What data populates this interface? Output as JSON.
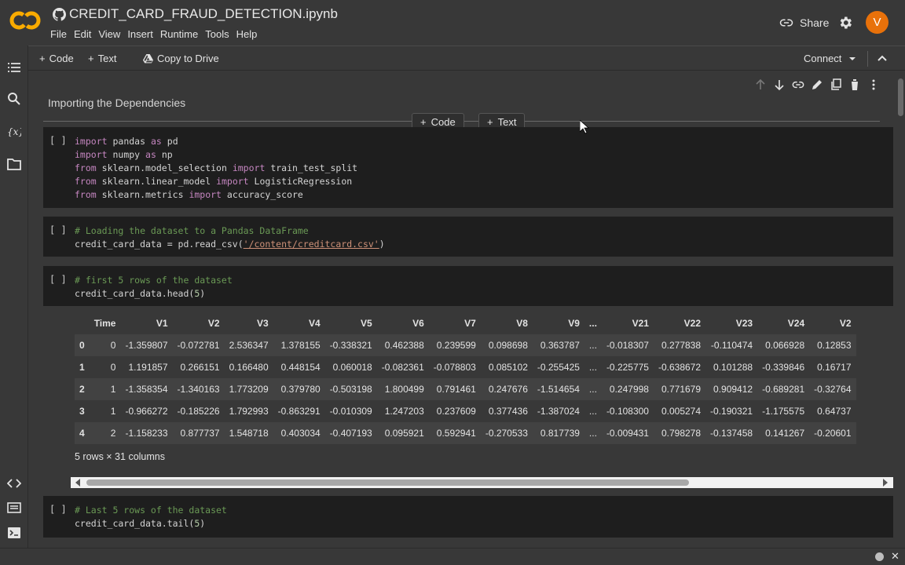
{
  "notebook": {
    "title": "CREDIT_CARD_FRAUD_DETECTION.ipynb"
  },
  "menu": [
    "File",
    "Edit",
    "View",
    "Insert",
    "Runtime",
    "Tools",
    "Help"
  ],
  "header": {
    "share_label": "Share",
    "avatar_letter": "V"
  },
  "toolbar": {
    "code_label": "Code",
    "text_label": "Text",
    "copy_label": "Copy to Drive",
    "connect_label": "Connect"
  },
  "text_cell": {
    "heading": "Importing the Dependencies"
  },
  "add_cell": {
    "code_label": "Code",
    "text_label": "Text"
  },
  "cells": [
    {
      "bracket": "[ ]"
    },
    {
      "bracket": "[ ]"
    },
    {
      "bracket": "[ ]"
    },
    {
      "bracket": "[ ]"
    }
  ],
  "code": {
    "c1": {
      "l1": [
        "import",
        "pandas",
        "as",
        "pd"
      ],
      "l2": [
        "import",
        "numpy",
        "as",
        "np"
      ],
      "l3": [
        "from",
        "sklearn.model_selection",
        "import",
        "train_test_split"
      ],
      "l4": [
        "from",
        "sklearn.linear_model",
        "import",
        "LogisticRegression"
      ],
      "l5": [
        "from",
        "sklearn.metrics",
        "import",
        "accuracy_score"
      ]
    },
    "c2": {
      "comment": "# Loading the dataset to a Pandas DataFrame",
      "pre": "credit_card_data = pd.read_csv(",
      "str": "'/content/creditcard.csv'",
      "post": ")"
    },
    "c3": {
      "comment": "# first 5 rows of the dataset",
      "pre": "credit_card_data.head(",
      "num": "5",
      "post": ")"
    },
    "c4": {
      "comment": "# Last 5 rows of the dataset",
      "pre": "credit_card_data.tail(",
      "num": "5",
      "post": ")"
    }
  },
  "table": {
    "columns": [
      "",
      "Time",
      "V1",
      "V2",
      "V3",
      "V4",
      "V5",
      "V6",
      "V7",
      "V8",
      "V9",
      "...",
      "V21",
      "V22",
      "V23",
      "V24",
      "V2"
    ],
    "rows": [
      [
        "0",
        "0",
        "-1.359807",
        "-0.072781",
        "2.536347",
        "1.378155",
        "-0.338321",
        "0.462388",
        "0.239599",
        "0.098698",
        "0.363787",
        "...",
        "-0.018307",
        "0.277838",
        "-0.110474",
        "0.066928",
        "0.12853"
      ],
      [
        "1",
        "0",
        "1.191857",
        "0.266151",
        "0.166480",
        "0.448154",
        "0.060018",
        "-0.082361",
        "-0.078803",
        "0.085102",
        "-0.255425",
        "...",
        "-0.225775",
        "-0.638672",
        "0.101288",
        "-0.339846",
        "0.16717"
      ],
      [
        "2",
        "1",
        "-1.358354",
        "-1.340163",
        "1.773209",
        "0.379780",
        "-0.503198",
        "1.800499",
        "0.791461",
        "0.247676",
        "-1.514654",
        "...",
        "0.247998",
        "0.771679",
        "0.909412",
        "-0.689281",
        "-0.32764"
      ],
      [
        "3",
        "1",
        "-0.966272",
        "-0.185226",
        "1.792993",
        "-0.863291",
        "-0.010309",
        "1.247203",
        "0.237609",
        "0.377436",
        "-1.387024",
        "...",
        "-0.108300",
        "0.005274",
        "-0.190321",
        "-1.175575",
        "0.64737"
      ],
      [
        "4",
        "2",
        "-1.158233",
        "0.877737",
        "1.548718",
        "0.403034",
        "-0.407193",
        "0.095921",
        "0.592941",
        "-0.270533",
        "0.817739",
        "...",
        "-0.009431",
        "0.798278",
        "-0.137458",
        "0.141267",
        "-0.20601"
      ]
    ],
    "row_count": "5 rows × 31 columns"
  },
  "status": {
    "close": "✕"
  },
  "colors": {
    "accent_orange": "#e8710a",
    "keyword": "#c586c0",
    "comment": "#6a9955",
    "string": "#ce9178",
    "number": "#b5cea8"
  },
  "icons": [
    "colab-logo",
    "github-icon",
    "link-icon",
    "gear-icon",
    "chevron-up-icon",
    "table-of-contents-icon",
    "search-icon",
    "variables-icon",
    "folder-icon",
    "code-snippets-icon",
    "command-palette-icon",
    "terminal-icon"
  ]
}
